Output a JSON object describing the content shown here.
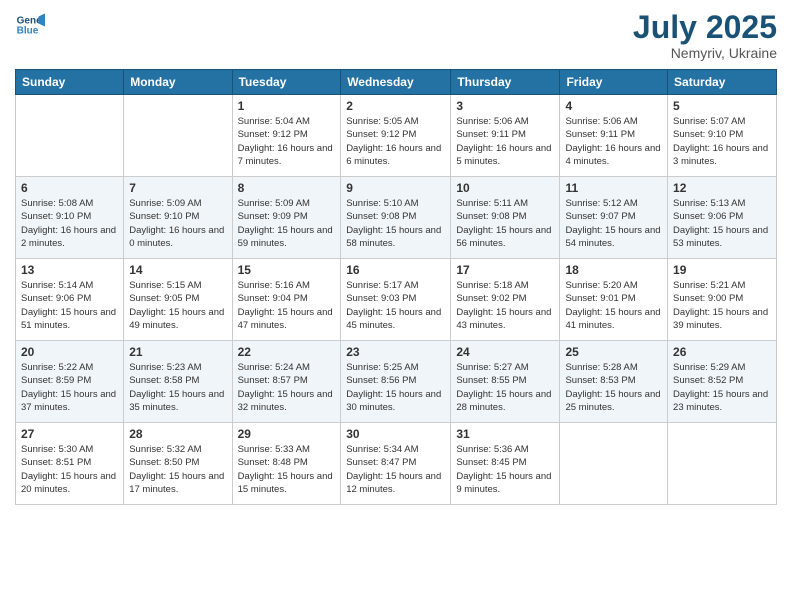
{
  "header": {
    "logo_line1": "General",
    "logo_line2": "Blue",
    "month_year": "July 2025",
    "location": "Nemyriv, Ukraine"
  },
  "days_of_week": [
    "Sunday",
    "Monday",
    "Tuesday",
    "Wednesday",
    "Thursday",
    "Friday",
    "Saturday"
  ],
  "weeks": [
    [
      {
        "day": "",
        "info": ""
      },
      {
        "day": "",
        "info": ""
      },
      {
        "day": "1",
        "info": "Sunrise: 5:04 AM\nSunset: 9:12 PM\nDaylight: 16 hours\nand 7 minutes."
      },
      {
        "day": "2",
        "info": "Sunrise: 5:05 AM\nSunset: 9:12 PM\nDaylight: 16 hours\nand 6 minutes."
      },
      {
        "day": "3",
        "info": "Sunrise: 5:06 AM\nSunset: 9:11 PM\nDaylight: 16 hours\nand 5 minutes."
      },
      {
        "day": "4",
        "info": "Sunrise: 5:06 AM\nSunset: 9:11 PM\nDaylight: 16 hours\nand 4 minutes."
      },
      {
        "day": "5",
        "info": "Sunrise: 5:07 AM\nSunset: 9:10 PM\nDaylight: 16 hours\nand 3 minutes."
      }
    ],
    [
      {
        "day": "6",
        "info": "Sunrise: 5:08 AM\nSunset: 9:10 PM\nDaylight: 16 hours\nand 2 minutes."
      },
      {
        "day": "7",
        "info": "Sunrise: 5:09 AM\nSunset: 9:10 PM\nDaylight: 16 hours\nand 0 minutes."
      },
      {
        "day": "8",
        "info": "Sunrise: 5:09 AM\nSunset: 9:09 PM\nDaylight: 15 hours\nand 59 minutes."
      },
      {
        "day": "9",
        "info": "Sunrise: 5:10 AM\nSunset: 9:08 PM\nDaylight: 15 hours\nand 58 minutes."
      },
      {
        "day": "10",
        "info": "Sunrise: 5:11 AM\nSunset: 9:08 PM\nDaylight: 15 hours\nand 56 minutes."
      },
      {
        "day": "11",
        "info": "Sunrise: 5:12 AM\nSunset: 9:07 PM\nDaylight: 15 hours\nand 54 minutes."
      },
      {
        "day": "12",
        "info": "Sunrise: 5:13 AM\nSunset: 9:06 PM\nDaylight: 15 hours\nand 53 minutes."
      }
    ],
    [
      {
        "day": "13",
        "info": "Sunrise: 5:14 AM\nSunset: 9:06 PM\nDaylight: 15 hours\nand 51 minutes."
      },
      {
        "day": "14",
        "info": "Sunrise: 5:15 AM\nSunset: 9:05 PM\nDaylight: 15 hours\nand 49 minutes."
      },
      {
        "day": "15",
        "info": "Sunrise: 5:16 AM\nSunset: 9:04 PM\nDaylight: 15 hours\nand 47 minutes."
      },
      {
        "day": "16",
        "info": "Sunrise: 5:17 AM\nSunset: 9:03 PM\nDaylight: 15 hours\nand 45 minutes."
      },
      {
        "day": "17",
        "info": "Sunrise: 5:18 AM\nSunset: 9:02 PM\nDaylight: 15 hours\nand 43 minutes."
      },
      {
        "day": "18",
        "info": "Sunrise: 5:20 AM\nSunset: 9:01 PM\nDaylight: 15 hours\nand 41 minutes."
      },
      {
        "day": "19",
        "info": "Sunrise: 5:21 AM\nSunset: 9:00 PM\nDaylight: 15 hours\nand 39 minutes."
      }
    ],
    [
      {
        "day": "20",
        "info": "Sunrise: 5:22 AM\nSunset: 8:59 PM\nDaylight: 15 hours\nand 37 minutes."
      },
      {
        "day": "21",
        "info": "Sunrise: 5:23 AM\nSunset: 8:58 PM\nDaylight: 15 hours\nand 35 minutes."
      },
      {
        "day": "22",
        "info": "Sunrise: 5:24 AM\nSunset: 8:57 PM\nDaylight: 15 hours\nand 32 minutes."
      },
      {
        "day": "23",
        "info": "Sunrise: 5:25 AM\nSunset: 8:56 PM\nDaylight: 15 hours\nand 30 minutes."
      },
      {
        "day": "24",
        "info": "Sunrise: 5:27 AM\nSunset: 8:55 PM\nDaylight: 15 hours\nand 28 minutes."
      },
      {
        "day": "25",
        "info": "Sunrise: 5:28 AM\nSunset: 8:53 PM\nDaylight: 15 hours\nand 25 minutes."
      },
      {
        "day": "26",
        "info": "Sunrise: 5:29 AM\nSunset: 8:52 PM\nDaylight: 15 hours\nand 23 minutes."
      }
    ],
    [
      {
        "day": "27",
        "info": "Sunrise: 5:30 AM\nSunset: 8:51 PM\nDaylight: 15 hours\nand 20 minutes."
      },
      {
        "day": "28",
        "info": "Sunrise: 5:32 AM\nSunset: 8:50 PM\nDaylight: 15 hours\nand 17 minutes."
      },
      {
        "day": "29",
        "info": "Sunrise: 5:33 AM\nSunset: 8:48 PM\nDaylight: 15 hours\nand 15 minutes."
      },
      {
        "day": "30",
        "info": "Sunrise: 5:34 AM\nSunset: 8:47 PM\nDaylight: 15 hours\nand 12 minutes."
      },
      {
        "day": "31",
        "info": "Sunrise: 5:36 AM\nSunset: 8:45 PM\nDaylight: 15 hours\nand 9 minutes."
      },
      {
        "day": "",
        "info": ""
      },
      {
        "day": "",
        "info": ""
      }
    ]
  ]
}
